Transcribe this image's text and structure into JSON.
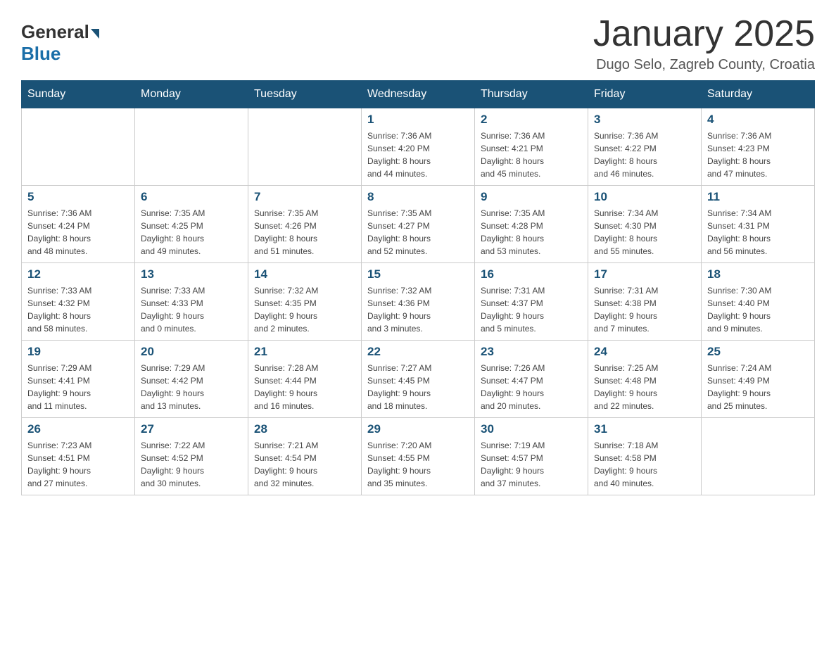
{
  "header": {
    "logo_general": "General",
    "logo_blue": "Blue",
    "title": "January 2025",
    "subtitle": "Dugo Selo, Zagreb County, Croatia"
  },
  "weekdays": [
    "Sunday",
    "Monday",
    "Tuesday",
    "Wednesday",
    "Thursday",
    "Friday",
    "Saturday"
  ],
  "weeks": [
    [
      {
        "day": "",
        "info": ""
      },
      {
        "day": "",
        "info": ""
      },
      {
        "day": "",
        "info": ""
      },
      {
        "day": "1",
        "info": "Sunrise: 7:36 AM\nSunset: 4:20 PM\nDaylight: 8 hours\nand 44 minutes."
      },
      {
        "day": "2",
        "info": "Sunrise: 7:36 AM\nSunset: 4:21 PM\nDaylight: 8 hours\nand 45 minutes."
      },
      {
        "day": "3",
        "info": "Sunrise: 7:36 AM\nSunset: 4:22 PM\nDaylight: 8 hours\nand 46 minutes."
      },
      {
        "day": "4",
        "info": "Sunrise: 7:36 AM\nSunset: 4:23 PM\nDaylight: 8 hours\nand 47 minutes."
      }
    ],
    [
      {
        "day": "5",
        "info": "Sunrise: 7:36 AM\nSunset: 4:24 PM\nDaylight: 8 hours\nand 48 minutes."
      },
      {
        "day": "6",
        "info": "Sunrise: 7:35 AM\nSunset: 4:25 PM\nDaylight: 8 hours\nand 49 minutes."
      },
      {
        "day": "7",
        "info": "Sunrise: 7:35 AM\nSunset: 4:26 PM\nDaylight: 8 hours\nand 51 minutes."
      },
      {
        "day": "8",
        "info": "Sunrise: 7:35 AM\nSunset: 4:27 PM\nDaylight: 8 hours\nand 52 minutes."
      },
      {
        "day": "9",
        "info": "Sunrise: 7:35 AM\nSunset: 4:28 PM\nDaylight: 8 hours\nand 53 minutes."
      },
      {
        "day": "10",
        "info": "Sunrise: 7:34 AM\nSunset: 4:30 PM\nDaylight: 8 hours\nand 55 minutes."
      },
      {
        "day": "11",
        "info": "Sunrise: 7:34 AM\nSunset: 4:31 PM\nDaylight: 8 hours\nand 56 minutes."
      }
    ],
    [
      {
        "day": "12",
        "info": "Sunrise: 7:33 AM\nSunset: 4:32 PM\nDaylight: 8 hours\nand 58 minutes."
      },
      {
        "day": "13",
        "info": "Sunrise: 7:33 AM\nSunset: 4:33 PM\nDaylight: 9 hours\nand 0 minutes."
      },
      {
        "day": "14",
        "info": "Sunrise: 7:32 AM\nSunset: 4:35 PM\nDaylight: 9 hours\nand 2 minutes."
      },
      {
        "day": "15",
        "info": "Sunrise: 7:32 AM\nSunset: 4:36 PM\nDaylight: 9 hours\nand 3 minutes."
      },
      {
        "day": "16",
        "info": "Sunrise: 7:31 AM\nSunset: 4:37 PM\nDaylight: 9 hours\nand 5 minutes."
      },
      {
        "day": "17",
        "info": "Sunrise: 7:31 AM\nSunset: 4:38 PM\nDaylight: 9 hours\nand 7 minutes."
      },
      {
        "day": "18",
        "info": "Sunrise: 7:30 AM\nSunset: 4:40 PM\nDaylight: 9 hours\nand 9 minutes."
      }
    ],
    [
      {
        "day": "19",
        "info": "Sunrise: 7:29 AM\nSunset: 4:41 PM\nDaylight: 9 hours\nand 11 minutes."
      },
      {
        "day": "20",
        "info": "Sunrise: 7:29 AM\nSunset: 4:42 PM\nDaylight: 9 hours\nand 13 minutes."
      },
      {
        "day": "21",
        "info": "Sunrise: 7:28 AM\nSunset: 4:44 PM\nDaylight: 9 hours\nand 16 minutes."
      },
      {
        "day": "22",
        "info": "Sunrise: 7:27 AM\nSunset: 4:45 PM\nDaylight: 9 hours\nand 18 minutes."
      },
      {
        "day": "23",
        "info": "Sunrise: 7:26 AM\nSunset: 4:47 PM\nDaylight: 9 hours\nand 20 minutes."
      },
      {
        "day": "24",
        "info": "Sunrise: 7:25 AM\nSunset: 4:48 PM\nDaylight: 9 hours\nand 22 minutes."
      },
      {
        "day": "25",
        "info": "Sunrise: 7:24 AM\nSunset: 4:49 PM\nDaylight: 9 hours\nand 25 minutes."
      }
    ],
    [
      {
        "day": "26",
        "info": "Sunrise: 7:23 AM\nSunset: 4:51 PM\nDaylight: 9 hours\nand 27 minutes."
      },
      {
        "day": "27",
        "info": "Sunrise: 7:22 AM\nSunset: 4:52 PM\nDaylight: 9 hours\nand 30 minutes."
      },
      {
        "day": "28",
        "info": "Sunrise: 7:21 AM\nSunset: 4:54 PM\nDaylight: 9 hours\nand 32 minutes."
      },
      {
        "day": "29",
        "info": "Sunrise: 7:20 AM\nSunset: 4:55 PM\nDaylight: 9 hours\nand 35 minutes."
      },
      {
        "day": "30",
        "info": "Sunrise: 7:19 AM\nSunset: 4:57 PM\nDaylight: 9 hours\nand 37 minutes."
      },
      {
        "day": "31",
        "info": "Sunrise: 7:18 AM\nSunset: 4:58 PM\nDaylight: 9 hours\nand 40 minutes."
      },
      {
        "day": "",
        "info": ""
      }
    ]
  ]
}
